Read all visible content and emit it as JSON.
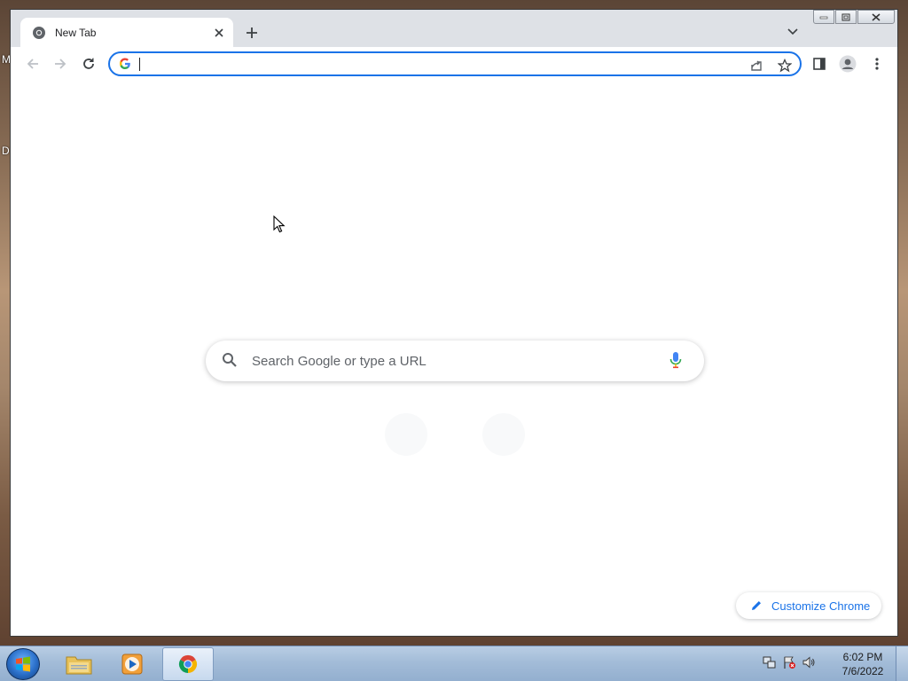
{
  "desktop": {
    "edge_letters": [
      "M",
      "D"
    ]
  },
  "browser": {
    "tab": {
      "title": "New Tab"
    },
    "omnibox": {
      "value": "",
      "placeholder": ""
    },
    "search": {
      "placeholder": "Search Google or type a URL"
    },
    "customize_label": "Customize Chrome"
  },
  "taskbar": {
    "items": [
      "windows-explorer",
      "windows-media-player",
      "google-chrome"
    ],
    "active_item": "google-chrome",
    "clock": {
      "time": "6:02 PM",
      "date": "7/6/2022"
    }
  },
  "colors": {
    "accent": "#1a73e8",
    "taskbar": "#a3bcd8",
    "tabstrip": "#dee1e6"
  }
}
